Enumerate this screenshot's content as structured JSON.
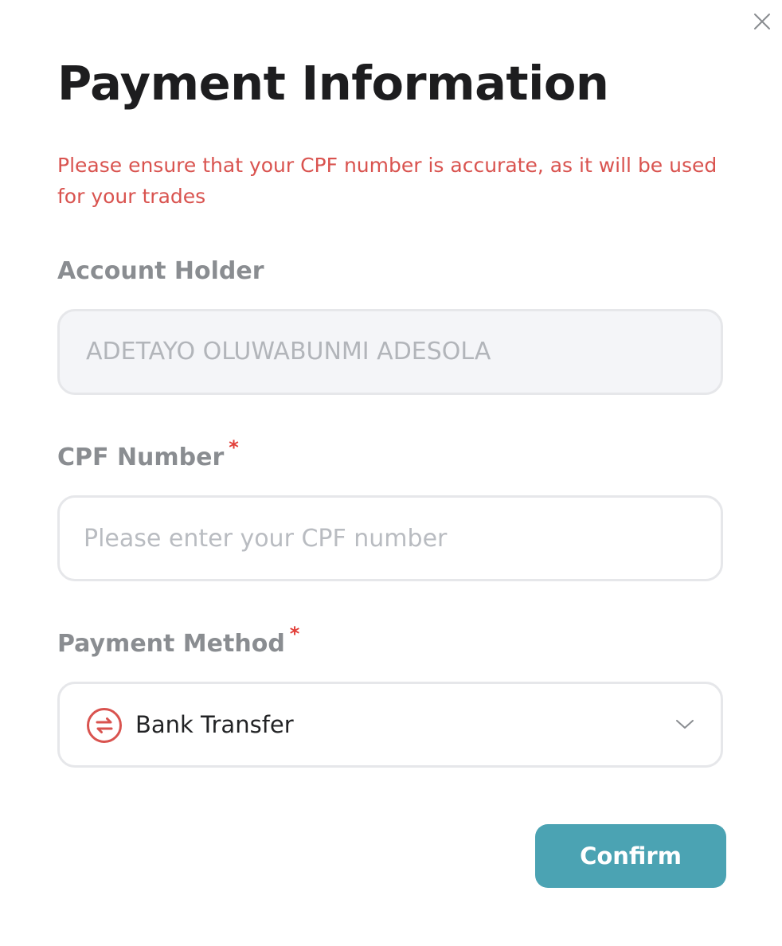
{
  "dialog": {
    "title": "Payment Information",
    "notice": "Please ensure that your CPF number is accurate, as it will be used for your trades"
  },
  "account_holder": {
    "label": "Account Holder",
    "value": "ADETAYO OLUWABUNMI ADESOLA"
  },
  "cpf": {
    "label": "CPF Number",
    "required_mark": "*",
    "value": "",
    "placeholder": "Please enter your CPF number"
  },
  "payment_method": {
    "label": "Payment Method",
    "required_mark": "*",
    "selected": "Bank Transfer",
    "icon": "transfer-arrows-icon"
  },
  "actions": {
    "confirm_label": "Confirm"
  },
  "colors": {
    "notice": "#d9534f",
    "required": "#e2403a",
    "confirm_button": "#4ba3b3",
    "method_icon": "#d9534f"
  }
}
